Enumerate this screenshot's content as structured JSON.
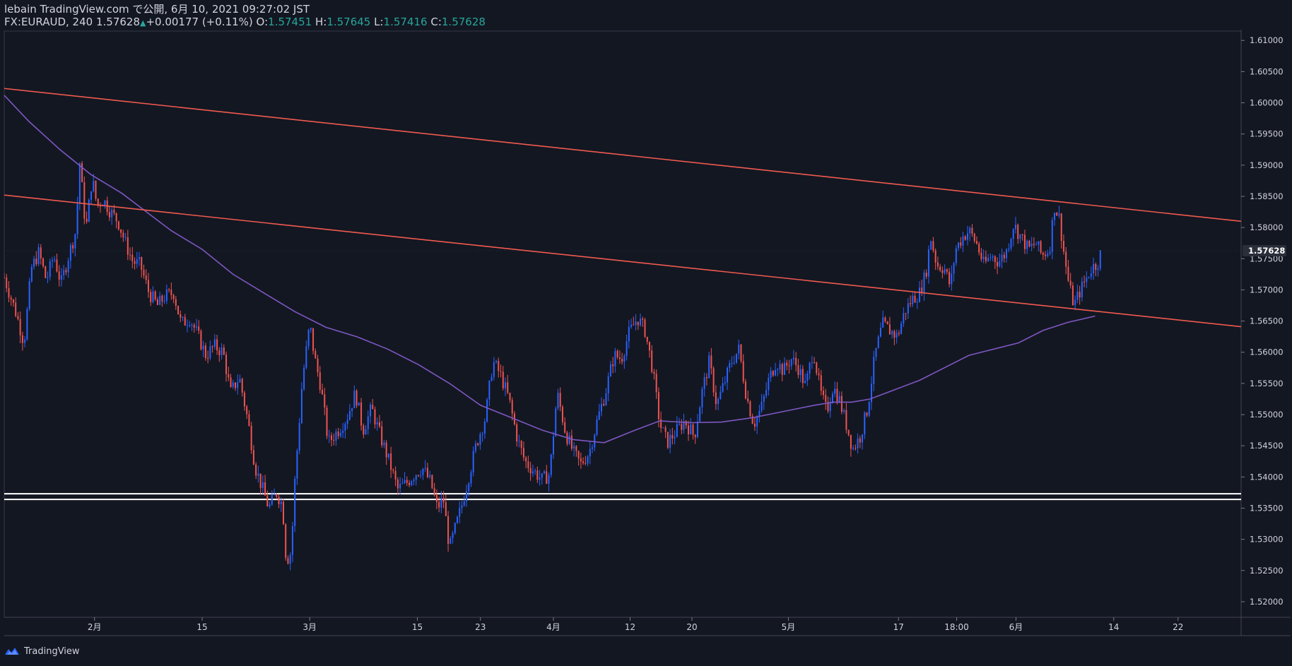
{
  "header": {
    "publisher_line": "lebain TradingView.com で公開, 6月 10, 2021 09:27:02 JST",
    "symbol": "FX:EURAUD, 240",
    "last": "1.57628",
    "change": "+0.00177 (+0.11%)",
    "o_label": "O:",
    "o_value": "1.57451",
    "h_label": "H:",
    "h_value": "1.57645",
    "l_label": "L:",
    "l_value": "1.57416",
    "c_label": "C:",
    "c_value": "1.57628"
  },
  "footer": {
    "brand": "TradingView"
  },
  "colors": {
    "background": "#131722",
    "up": "#2962ff",
    "down": "#ef5350",
    "trendline": "#f05a4f",
    "moving_average": "#7e57c2",
    "support": "#ffffff",
    "grid": "#1e222d",
    "axis_text": "#d1d4dc"
  },
  "chart_data": {
    "type": "candlestick",
    "symbol": "FX:EURAUD",
    "timeframe": "240",
    "x_ticks": [
      "2月",
      "15",
      "3月",
      "15",
      "23",
      "4月",
      "12",
      "20",
      "5月",
      "17",
      "18:00",
      "6月",
      "14",
      "22"
    ],
    "y_ticks": [
      "1.61000",
      "1.60500",
      "1.60000",
      "1.59500",
      "1.59000",
      "1.58500",
      "1.58000",
      "1.57500",
      "1.57000",
      "1.56500",
      "1.56000",
      "1.55500",
      "1.55000",
      "1.54500",
      "1.54000",
      "1.53500",
      "1.53000",
      "1.52500",
      "1.52000"
    ],
    "ylim": [
      1.5175,
      1.6115
    ],
    "x_tick_positions": [
      0.073,
      0.16,
      0.247,
      0.334,
      0.385,
      0.444,
      0.506,
      0.556,
      0.634,
      0.723,
      0.77,
      0.818,
      0.897,
      0.949
    ],
    "last_price": "1.57628",
    "close_path": [
      [
        0.0,
        1.572
      ],
      [
        0.01,
        1.566
      ],
      [
        0.016,
        1.5615
      ],
      [
        0.022,
        1.5735
      ],
      [
        0.028,
        1.576
      ],
      [
        0.034,
        1.5715
      ],
      [
        0.04,
        1.5755
      ],
      [
        0.046,
        1.571
      ],
      [
        0.052,
        1.5755
      ],
      [
        0.058,
        1.5795
      ],
      [
        0.061,
        1.5905
      ],
      [
        0.066,
        1.5795
      ],
      [
        0.071,
        1.588
      ],
      [
        0.075,
        1.5835
      ],
      [
        0.08,
        1.5845
      ],
      [
        0.086,
        1.5825
      ],
      [
        0.092,
        1.581
      ],
      [
        0.098,
        1.5775
      ],
      [
        0.104,
        1.5745
      ],
      [
        0.11,
        1.574
      ],
      [
        0.117,
        1.5695
      ],
      [
        0.124,
        1.5675
      ],
      [
        0.13,
        1.569
      ],
      [
        0.137,
        1.5695
      ],
      [
        0.143,
        1.5645
      ],
      [
        0.15,
        1.5655
      ],
      [
        0.157,
        1.5625
      ],
      [
        0.163,
        1.5595
      ],
      [
        0.17,
        1.561
      ],
      [
        0.177,
        1.56
      ],
      [
        0.183,
        1.5535
      ],
      [
        0.19,
        1.556
      ],
      [
        0.197,
        1.549
      ],
      [
        0.203,
        1.5415
      ],
      [
        0.209,
        1.538
      ],
      [
        0.214,
        1.535
      ],
      [
        0.22,
        1.5375
      ],
      [
        0.225,
        1.5355
      ],
      [
        0.228,
        1.5265
      ],
      [
        0.232,
        1.528
      ],
      [
        0.235,
        1.5395
      ],
      [
        0.241,
        1.5555
      ],
      [
        0.247,
        1.5645
      ],
      [
        0.251,
        1.559
      ],
      [
        0.256,
        1.5545
      ],
      [
        0.262,
        1.5455
      ],
      [
        0.27,
        1.5475
      ],
      [
        0.277,
        1.5495
      ],
      [
        0.284,
        1.5535
      ],
      [
        0.29,
        1.5475
      ],
      [
        0.297,
        1.551
      ],
      [
        0.305,
        1.546
      ],
      [
        0.312,
        1.542
      ],
      [
        0.318,
        1.538
      ],
      [
        0.325,
        1.539
      ],
      [
        0.332,
        1.5405
      ],
      [
        0.338,
        1.5415
      ],
      [
        0.345,
        1.539
      ],
      [
        0.35,
        1.535
      ],
      [
        0.355,
        1.5365
      ],
      [
        0.36,
        1.5285
      ],
      [
        0.365,
        1.532
      ],
      [
        0.37,
        1.5355
      ],
      [
        0.376,
        1.5405
      ],
      [
        0.382,
        1.5455
      ],
      [
        0.389,
        1.5495
      ],
      [
        0.395,
        1.5585
      ],
      [
        0.401,
        1.5565
      ],
      [
        0.408,
        1.5525
      ],
      [
        0.415,
        1.546
      ],
      [
        0.421,
        1.5425
      ],
      [
        0.428,
        1.541
      ],
      [
        0.435,
        1.5395
      ],
      [
        0.441,
        1.5405
      ],
      [
        0.447,
        1.5535
      ],
      [
        0.454,
        1.547
      ],
      [
        0.46,
        1.544
      ],
      [
        0.466,
        1.542
      ],
      [
        0.473,
        1.544
      ],
      [
        0.48,
        1.5495
      ],
      [
        0.486,
        1.5535
      ],
      [
        0.493,
        1.5595
      ],
      [
        0.499,
        1.559
      ],
      [
        0.505,
        1.563
      ],
      [
        0.512,
        1.5655
      ],
      [
        0.518,
        1.5635
      ],
      [
        0.524,
        1.5575
      ],
      [
        0.53,
        1.5485
      ],
      [
        0.536,
        1.5455
      ],
      [
        0.542,
        1.547
      ],
      [
        0.55,
        1.549
      ],
      [
        0.558,
        1.5465
      ],
      [
        0.564,
        1.5535
      ],
      [
        0.57,
        1.5585
      ],
      [
        0.576,
        1.5515
      ],
      [
        0.582,
        1.555
      ],
      [
        0.588,
        1.5585
      ],
      [
        0.594,
        1.5605
      ],
      [
        0.6,
        1.553
      ],
      [
        0.606,
        1.5485
      ],
      [
        0.612,
        1.551
      ],
      [
        0.618,
        1.5555
      ],
      [
        0.624,
        1.5585
      ],
      [
        0.63,
        1.557
      ],
      [
        0.636,
        1.559
      ],
      [
        0.642,
        1.5575
      ],
      [
        0.648,
        1.5545
      ],
      [
        0.654,
        1.5605
      ],
      [
        0.66,
        1.5535
      ],
      [
        0.665,
        1.5505
      ],
      [
        0.67,
        1.5545
      ],
      [
        0.675,
        1.5525
      ],
      [
        0.68,
        1.549
      ],
      [
        0.686,
        1.5445
      ],
      [
        0.692,
        1.5465
      ],
      [
        0.698,
        1.551
      ],
      [
        0.704,
        1.5595
      ],
      [
        0.71,
        1.5645
      ],
      [
        0.716,
        1.5635
      ],
      [
        0.722,
        1.5625
      ],
      [
        0.728,
        1.5665
      ],
      [
        0.734,
        1.5685
      ],
      [
        0.74,
        1.5695
      ],
      [
        0.745,
        1.5725
      ],
      [
        0.749,
        1.5785
      ],
      [
        0.754,
        1.574
      ],
      [
        0.76,
        1.5735
      ],
      [
        0.765,
        1.5705
      ],
      [
        0.769,
        1.5765
      ],
      [
        0.775,
        1.5785
      ],
      [
        0.78,
        1.5795
      ],
      [
        0.786,
        1.5775
      ],
      [
        0.792,
        1.574
      ],
      [
        0.798,
        1.5755
      ],
      [
        0.804,
        1.5745
      ],
      [
        0.81,
        1.576
      ],
      [
        0.816,
        1.5805
      ],
      [
        0.822,
        1.5785
      ],
      [
        0.828,
        1.5765
      ],
      [
        0.834,
        1.5775
      ],
      [
        0.839,
        1.5755
      ],
      [
        0.845,
        1.5765
      ],
      [
        0.849,
        1.5835
      ],
      [
        0.853,
        1.5815
      ],
      [
        0.857,
        1.5755
      ],
      [
        0.861,
        1.5705
      ],
      [
        0.865,
        1.5675
      ],
      [
        0.869,
        1.5695
      ],
      [
        0.874,
        1.5715
      ],
      [
        0.879,
        1.5735
      ],
      [
        0.884,
        1.5743
      ],
      [
        0.887,
        1.5762
      ]
    ],
    "moving_average": [
      [
        0.0,
        1.6012
      ],
      [
        0.02,
        1.597
      ],
      [
        0.045,
        1.5925
      ],
      [
        0.07,
        1.5885
      ],
      [
        0.095,
        1.5855
      ],
      [
        0.115,
        1.5825
      ],
      [
        0.135,
        1.5795
      ],
      [
        0.16,
        1.5765
      ],
      [
        0.185,
        1.5725
      ],
      [
        0.21,
        1.5695
      ],
      [
        0.235,
        1.5665
      ],
      [
        0.26,
        1.564
      ],
      [
        0.285,
        1.5625
      ],
      [
        0.31,
        1.5605
      ],
      [
        0.335,
        1.558
      ],
      [
        0.36,
        1.555
      ],
      [
        0.385,
        1.5515
      ],
      [
        0.41,
        1.5495
      ],
      [
        0.435,
        1.5475
      ],
      [
        0.46,
        1.546
      ],
      [
        0.485,
        1.5455
      ],
      [
        0.51,
        1.5475
      ],
      [
        0.53,
        1.549
      ],
      [
        0.555,
        1.5487
      ],
      [
        0.58,
        1.5488
      ],
      [
        0.605,
        1.5495
      ],
      [
        0.63,
        1.5505
      ],
      [
        0.655,
        1.5515
      ],
      [
        0.67,
        1.552
      ],
      [
        0.685,
        1.552
      ],
      [
        0.7,
        1.5525
      ],
      [
        0.72,
        1.554
      ],
      [
        0.74,
        1.5555
      ],
      [
        0.76,
        1.5575
      ],
      [
        0.78,
        1.5595
      ],
      [
        0.8,
        1.5605
      ],
      [
        0.82,
        1.5615
      ],
      [
        0.84,
        1.5635
      ],
      [
        0.86,
        1.5648
      ],
      [
        0.882,
        1.5658
      ]
    ],
    "trendlines": [
      {
        "name": "",
        "points": [
          [
            0.0,
            1.6023
          ],
          [
            1.0,
            1.581
          ]
        ]
      },
      {
        "name": "",
        "points": [
          [
            0.0,
            1.5852
          ],
          [
            1.0,
            1.5641
          ]
        ]
      }
    ],
    "horizontal_lines": [
      1.5373,
      1.5364
    ],
    "grid": false,
    "legend": "none"
  }
}
